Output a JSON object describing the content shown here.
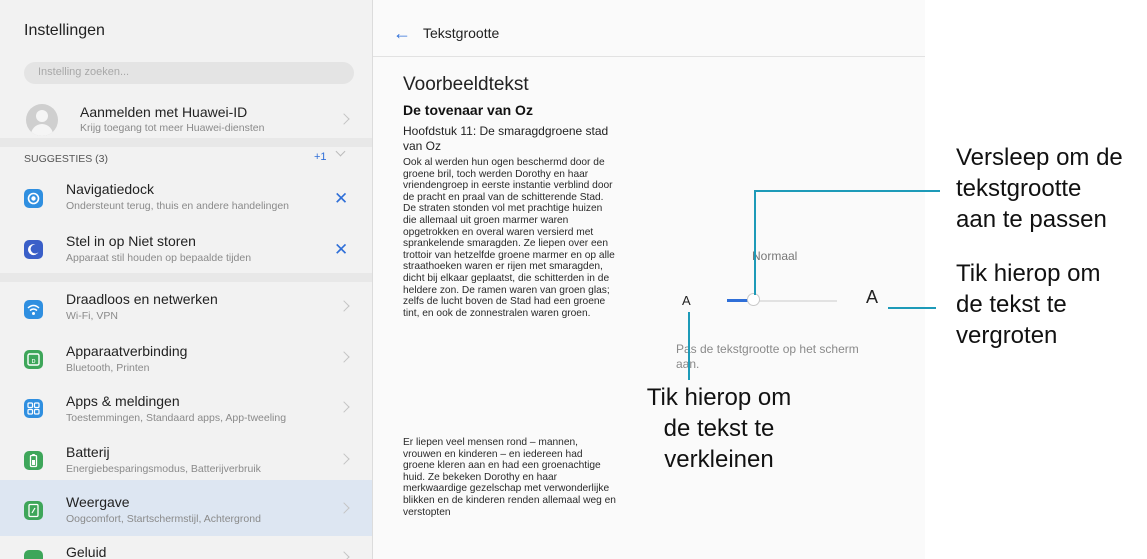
{
  "left_panel": {
    "title": "Instellingen",
    "search_placeholder": "Instelling zoeken...",
    "account": {
      "title": "Aanmelden met Huawei-ID",
      "subtitle": "Krijg toegang tot meer Huawei-diensten"
    },
    "suggestions": {
      "label": "SUGGESTIES (3)",
      "count": "+1"
    },
    "suggestion_items": [
      {
        "title": "Navigatiedock",
        "subtitle": "Ondersteunt terug, thuis en andere handelingen"
      },
      {
        "title": "Stel in op Niet storen",
        "subtitle": "Apparaat stil houden op bepaalde tijden"
      }
    ],
    "items": [
      {
        "title": "Draadloos en netwerken",
        "subtitle": "Wi-Fi, VPN",
        "icon": "wifi-icon",
        "color": "#2f8fe0"
      },
      {
        "title": "Apparaatverbinding",
        "subtitle": "Bluetooth, Printen",
        "icon": "device-connection-icon",
        "color": "#3ea65a"
      },
      {
        "title": "Apps & meldingen",
        "subtitle": "Toestemmingen, Standaard apps, App-tweeling",
        "icon": "apps-icon",
        "color": "#2f8fe0"
      },
      {
        "title": "Batterij",
        "subtitle": "Energiebesparingsmodus, Batterijverbruik",
        "icon": "battery-icon",
        "color": "#3ea65a"
      },
      {
        "title": "Weergave",
        "subtitle": "Oogcomfort, Startschermstijl, Achtergrond",
        "icon": "display-icon",
        "color": "#3ea65a",
        "selected": true
      },
      {
        "title": "Geluid",
        "subtitle": "",
        "icon": "sound-icon",
        "color": "#3ea65a"
      }
    ]
  },
  "right_panel": {
    "title": "Tekstgrootte",
    "sample_heading": "Voorbeeldtekst",
    "sample_subheading": "De tovenaar van Oz",
    "chapter": "Hoofdstuk 11: De smaragdgroene stad van Oz",
    "paragraph1": "Ook al werden hun ogen beschermd door de groene bril, toch werden Dorothy en haar vriendengroep in eerste instantie verblind door de pracht en praal van de schitterende Stad. De straten stonden vol met prachtige huizen die allemaal uit groen marmer waren opgetrokken en overal waren versierd met sprankelende smaragden. Ze liepen over een trottoir van hetzelfde groene marmer en op alle straathoeken waren er rijen met smaragden, dicht bij elkaar geplaatst, die schitterden in de heldere zon. De ramen waren van groen glas; zelfs de lucht boven de Stad had een groene tint, en ook de zonnestralen waren groen.",
    "paragraph2": "Er liepen veel mensen rond – mannen, vrouwen en kinderen – en iedereen had groene kleren aan en had een groenachtige huid. Ze bekeken Dorothy en haar merkwaardige gezelschap met verwonderlijke blikken en de kinderen renden allemaal weg en verstopten",
    "slider": {
      "label": "Normaal",
      "small_a": "A",
      "large_a": "A",
      "value_fraction": 0.25
    },
    "hint": "Pas de tekstgrootte op het scherm aan."
  },
  "callouts": {
    "drag": [
      "Versleep om de",
      "tekstgrootte",
      "aan te passen"
    ],
    "enlarge": [
      "Tik hierop om",
      "de tekst te",
      "vergroten"
    ],
    "shrink": [
      "Tik hierop om",
      "de tekst te",
      "verkleinen"
    ]
  },
  "colors": {
    "accent": "#2f6fd8",
    "callout_line": "#1d9ab8",
    "selected_row": "#dde6f2"
  }
}
